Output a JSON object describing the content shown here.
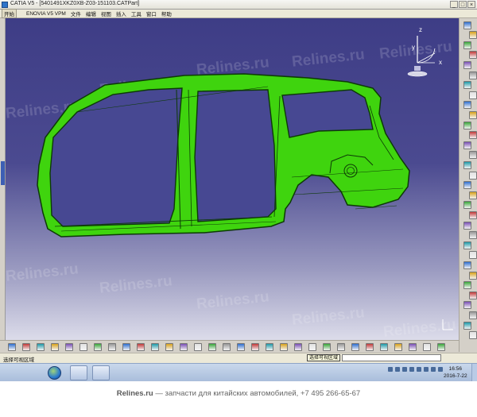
{
  "window": {
    "title": "CATIA V5 - [5401491XKZ0XB-Z03-151103.CATPart]",
    "buttons": [
      "_",
      "□",
      "×"
    ]
  },
  "menubar": {
    "items": [
      "开始",
      "ENOVIA V5 VPM",
      "文件",
      "编辑",
      "视图",
      "插入",
      "工具",
      "窗口",
      "帮助"
    ]
  },
  "compass": {
    "axis_x": "x",
    "axis_y": "y",
    "axis_z": "z"
  },
  "watermark": {
    "text": "Relines.ru"
  },
  "statusbar": {
    "status": "选择可视区域",
    "tooltip": "选择可视区域",
    "command_value": ""
  },
  "taskbar": {
    "clock_time": "16:56",
    "clock_date": "2016-7-22"
  },
  "footer": {
    "brand": "Relines.ru",
    "tagline": " — запчасти для китайских автомобилей, +7 495 266-65-67"
  },
  "colors": {
    "viewport_top": "#3e3d86",
    "part_green": "#3fd40e",
    "part_outline": "#0d3a06"
  },
  "icons": {
    "right_toolbar": [
      "gear-icon",
      "sketch-icon",
      "plane-icon",
      "point-icon",
      "line-icon",
      "curve-icon",
      "circle-icon",
      "spline-icon",
      "corner-icon",
      "connect-icon",
      "surface-icon",
      "extrude-icon",
      "revolve-icon",
      "sweep-icon",
      "fill-icon",
      "loft-icon",
      "blend-icon",
      "join-icon",
      "split-icon",
      "trim-icon",
      "boundary-icon",
      "extract-icon",
      "fillet-icon",
      "translate-icon",
      "rotate-icon",
      "symmetry-icon",
      "scale-icon",
      "affinity-icon",
      "pattern-icon",
      "measure-icon",
      "analysis-icon",
      "tools-icon"
    ],
    "bottom_toolbar": [
      "new-icon",
      "open-icon",
      "save-icon",
      "print-icon",
      "cut-icon",
      "copy-icon",
      "paste-icon",
      "undo-icon",
      "redo-icon",
      "whatsthis-icon",
      "update-icon",
      "sketch-icon",
      "hide-icon",
      "swap-icon",
      "fly-icon",
      "fit-all-icon",
      "pan-icon",
      "rotate-icon",
      "zoom-in-icon",
      "zoom-out-icon",
      "normal-view-icon",
      "iso-view-icon",
      "shading-icon",
      "wire-icon",
      "material-icon",
      "snap-icon",
      "measure-icon",
      "catalog-icon",
      "inertia-icon",
      "select-icon",
      "catia-logo-icon"
    ]
  }
}
